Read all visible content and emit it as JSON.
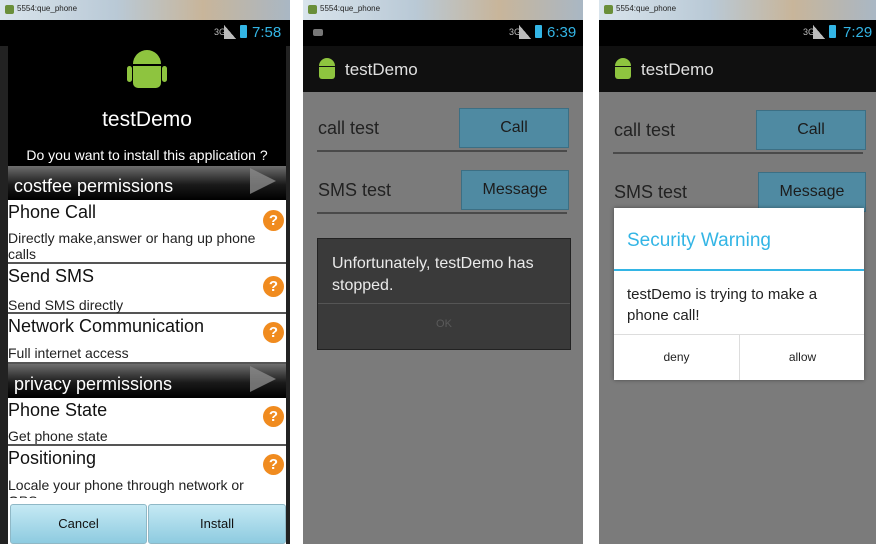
{
  "screens": [
    {
      "window_title": "5554:que_phone",
      "status_bar": {
        "network": "3G",
        "time": "7:58"
      },
      "app_title": "testDemo",
      "install_question": "Do you want to install this application ?",
      "sections": [
        {
          "label": "costfee permissions",
          "items": [
            {
              "title": "Phone Call",
              "description": "Directly make,answer or hang up phone calls"
            },
            {
              "title": "Send SMS",
              "description": "Send SMS directly"
            },
            {
              "title": "Network Communication",
              "description": "Full internet access"
            }
          ]
        },
        {
          "label": "privacy permissions",
          "items": [
            {
              "title": "Phone State",
              "description": "Get phone state"
            },
            {
              "title": "Positioning",
              "description": "Locale your phone through network or GPS"
            }
          ]
        }
      ],
      "help_icon": "?",
      "buttons": {
        "cancel": "Cancel",
        "install": "Install"
      }
    },
    {
      "window_title": "5554:que_phone",
      "status_bar": {
        "network": "3G",
        "time": "6:39"
      },
      "app_title": "testDemo",
      "rows": [
        {
          "label": "call test",
          "button": "Call"
        },
        {
          "label": "SMS test",
          "button": "Message"
        }
      ],
      "error_dialog": {
        "message": "Unfortunately, testDemo has stopped.",
        "ok_label": "OK"
      }
    },
    {
      "window_title": "5554:que_phone",
      "status_bar": {
        "network": "3G",
        "time": "7:29"
      },
      "app_title": "testDemo",
      "rows": [
        {
          "label": "call test",
          "button": "Call"
        },
        {
          "label": "SMS test",
          "button": "Message"
        }
      ],
      "warning_dialog": {
        "title": "Security Warning",
        "message": "testDemo is trying to make a phone call!",
        "deny_label": "deny",
        "allow_label": "allow"
      }
    }
  ],
  "colors": {
    "holo_blue": "#33b5e5",
    "android_green": "#8ec43f",
    "help_orange": "#f08b1f"
  }
}
